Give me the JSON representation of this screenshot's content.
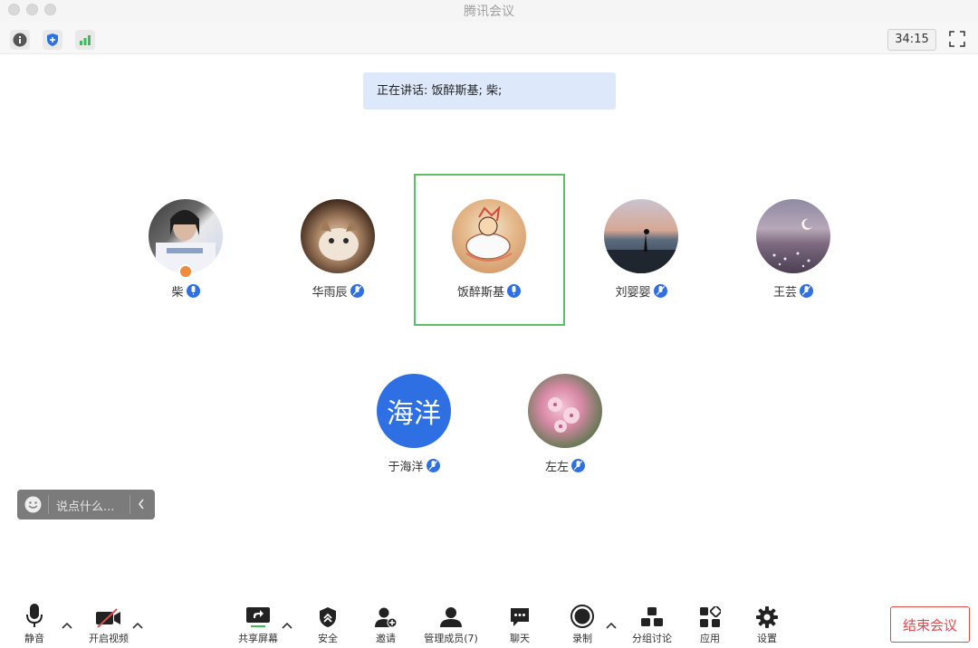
{
  "window": {
    "title": "腾讯会议"
  },
  "top_toolbar": {
    "timer": "34:15"
  },
  "speaking": {
    "text": "正在讲话: 饭醉斯基; 柴;"
  },
  "participants": [
    {
      "name": "柴"
    },
    {
      "name": "华雨辰"
    },
    {
      "name": "饭醉斯基"
    },
    {
      "name": "刘婴婴"
    },
    {
      "name": "王芸"
    },
    {
      "name": "于海洋",
      "avatar_text": "海洋"
    },
    {
      "name": "左左"
    }
  ],
  "chat": {
    "placeholder": "说点什么..."
  },
  "bottom": {
    "mute": "静音",
    "video": "开启视频",
    "share": "共享屏幕",
    "security": "安全",
    "invite": "邀请",
    "members": "管理成员(7)",
    "chat": "聊天",
    "record": "录制",
    "breakout": "分组讨论",
    "apps": "应用",
    "settings": "设置",
    "end": "结束会议"
  },
  "colors": {
    "accent": "#2f6fe4",
    "highlight": "#5fbf66",
    "end": "#e04b4b",
    "speaking_bg": "#dde9fb"
  }
}
